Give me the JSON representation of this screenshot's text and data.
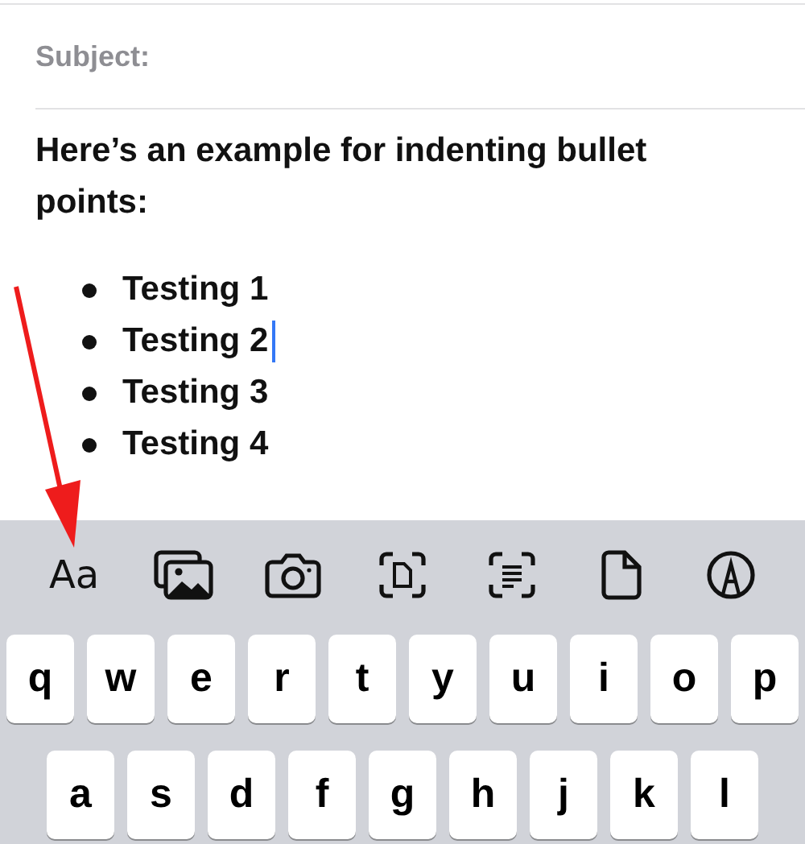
{
  "compose": {
    "subject_label": "Subject:",
    "intro": "Here’s an example for indenting bullet points:",
    "bullets": [
      {
        "text": "Testing 1",
        "cursor": false
      },
      {
        "text": "Testing 2",
        "cursor": true
      },
      {
        "text": "Testing 3",
        "cursor": false
      },
      {
        "text": "Testing 4",
        "cursor": false
      }
    ]
  },
  "toolbar": {
    "format_label": "Aa",
    "icons": [
      {
        "kind": "photos"
      },
      {
        "kind": "camera"
      },
      {
        "kind": "scan-document"
      },
      {
        "kind": "scan-text"
      },
      {
        "kind": "file"
      },
      {
        "kind": "markup"
      }
    ]
  },
  "keyboard": {
    "rows": [
      [
        "q",
        "w",
        "e",
        "r",
        "t",
        "y",
        "u",
        "i",
        "o",
        "p"
      ],
      [
        "a",
        "s",
        "d",
        "f",
        "g",
        "h",
        "j",
        "k",
        "l"
      ]
    ]
  }
}
